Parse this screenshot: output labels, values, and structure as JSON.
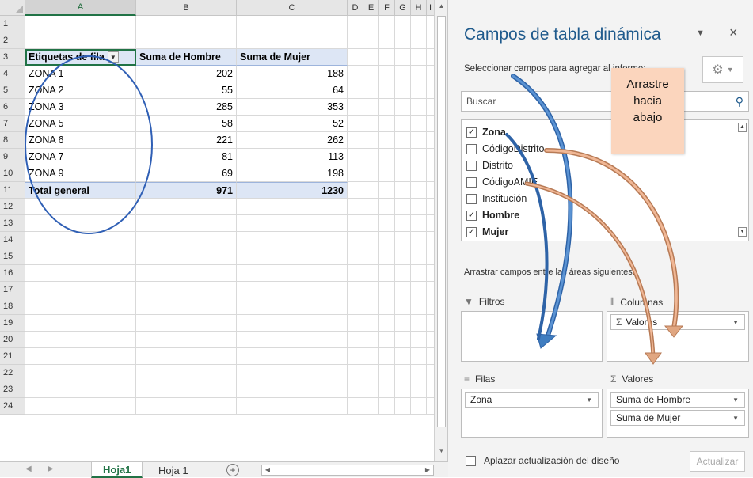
{
  "sheet": {
    "columns": [
      "A",
      "B",
      "C",
      "D",
      "E",
      "F",
      "G",
      "H",
      "I"
    ],
    "rows": [
      "1",
      "2",
      "3",
      "4",
      "5",
      "6",
      "7",
      "8",
      "9",
      "10",
      "11",
      "12",
      "13",
      "14",
      "15",
      "16",
      "17",
      "18",
      "19",
      "20",
      "21",
      "22",
      "23",
      "24"
    ],
    "pivot_header": {
      "row_labels": "Etiquetas de fila",
      "col_b": "Suma de Hombre",
      "col_c": "Suma de Mujer"
    },
    "pivot_rows": [
      {
        "label": "ZONA 1",
        "hombre": "202",
        "mujer": "188"
      },
      {
        "label": "ZONA 2",
        "hombre": "55",
        "mujer": "64"
      },
      {
        "label": "ZONA 3",
        "hombre": "285",
        "mujer": "353"
      },
      {
        "label": "ZONA 5",
        "hombre": "58",
        "mujer": "52"
      },
      {
        "label": "ZONA 6",
        "hombre": "221",
        "mujer": "262"
      },
      {
        "label": "ZONA 7",
        "hombre": "81",
        "mujer": "113"
      },
      {
        "label": "ZONA 9",
        "hombre": "69",
        "mujer": "198"
      }
    ],
    "total": {
      "label": "Total general",
      "hombre": "971",
      "mujer": "1230"
    },
    "tabs": {
      "active": "Hoja1",
      "other": "Hoja 1"
    }
  },
  "pane": {
    "title": "Campos de tabla dinámica",
    "choose_label": "Seleccionar campos para agregar al informe:",
    "search_placeholder": "Buscar",
    "fields": [
      {
        "name": "Zona",
        "checked": true
      },
      {
        "name": "CódigoDistrito",
        "checked": false
      },
      {
        "name": "Distrito",
        "checked": false
      },
      {
        "name": "CódigoAMIE",
        "checked": false
      },
      {
        "name": "Institución",
        "checked": false
      },
      {
        "name": "Hombre",
        "checked": true
      },
      {
        "name": "Mujer",
        "checked": true
      }
    ],
    "drag_hint": "Arrastrar campos entre las áreas siguientes:",
    "areas": {
      "filters": {
        "label": "Filtros",
        "items": []
      },
      "columns": {
        "label": "Columnas",
        "items": [
          "Valores"
        ]
      },
      "rows": {
        "label": "Filas",
        "items": [
          "Zona"
        ]
      },
      "values": {
        "label": "Valores",
        "items": [
          "Suma de Hombre",
          "Suma de Mujer"
        ]
      }
    },
    "defer_label": "Aplazar actualización del diseño",
    "update_label": "Actualizar"
  },
  "callout": {
    "lines": [
      "Arrastre",
      "hacia",
      "abajo"
    ]
  },
  "colors": {
    "accent_green": "#217346",
    "pivot_header_bg": "#dde6f5",
    "pane_title": "#1f5a8c",
    "arrow_blue": "#3f7dc0",
    "arrow_orange": "#e0a681",
    "callout_bg": "#fbd5bd",
    "ellipse_stroke": "#2f5fb5"
  },
  "icons": [
    "filter-dropdown-icon",
    "gear-icon",
    "search-icon",
    "close-icon",
    "chevron-down-icon",
    "filter-funnel-icon",
    "columns-icon",
    "rows-icon",
    "sigma-icon",
    "add-sheet-icon"
  ]
}
